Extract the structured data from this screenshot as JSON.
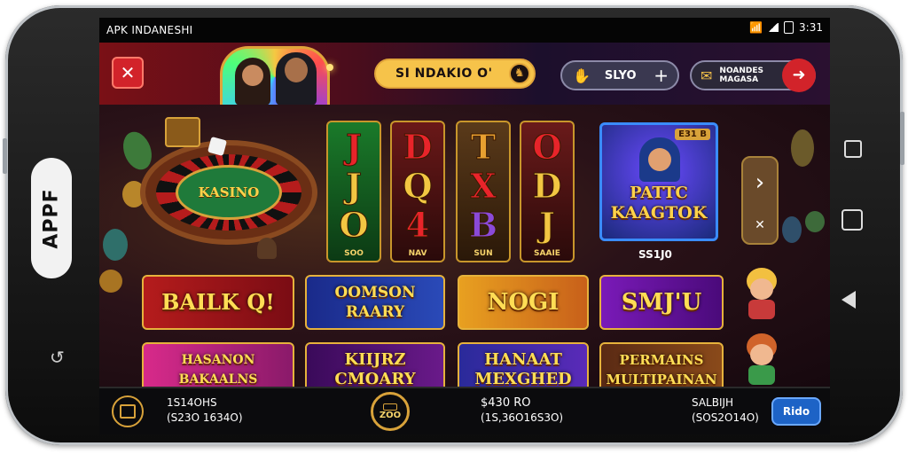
{
  "side_label": "APPF",
  "status": {
    "title": "APK INDANESHI",
    "time": "3:31"
  },
  "topbar": {
    "center_label": "SI NDAKIO O'",
    "balance_label": "SLYO",
    "promo_label": "NOANDES MAGASA"
  },
  "roulette": {
    "label": "KASINO"
  },
  "reels": [
    {
      "symbols": [
        "J",
        "J",
        "O"
      ],
      "label": "SOO"
    },
    {
      "symbols": [
        "D",
        "Q",
        "4"
      ],
      "label": "NAV"
    },
    {
      "symbols": [
        "T",
        "X",
        "B"
      ],
      "label": "SUN"
    },
    {
      "symbols": [
        "O",
        "D",
        "J"
      ],
      "label": "SAAIE"
    }
  ],
  "featured": {
    "badge": "E31 B",
    "line1": "PATTC",
    "line2": "KAAGTOK",
    "caption": "SS1J0"
  },
  "tiles": [
    {
      "text": "BAILK Q!"
    },
    {
      "text": "OOMSON RAARY"
    },
    {
      "text": "NOGI"
    },
    {
      "text": "SMJ'U"
    },
    {
      "text": "HASANON BAKAALNS"
    },
    {
      "text": "KIIJRZ CMOARY"
    },
    {
      "text": "HANAAT MEXGHED"
    },
    {
      "text": "PERMAINS MULTIPAINAN"
    }
  ],
  "bottom": {
    "left_top": "1S14OHS",
    "left_bottom": "(S23O 1634O)",
    "coin_label": "ZOO",
    "mid_top": "$430 RO",
    "mid_bottom": "(1S,36O16S3O)",
    "right_top": "SALBIJH",
    "right_bottom": "(SOS2O14O)",
    "button_label": "Rido"
  },
  "colors": {
    "accent_gold": "#e0a43a",
    "close_red": "#d2232a",
    "button_blue": "#1d63c6"
  }
}
